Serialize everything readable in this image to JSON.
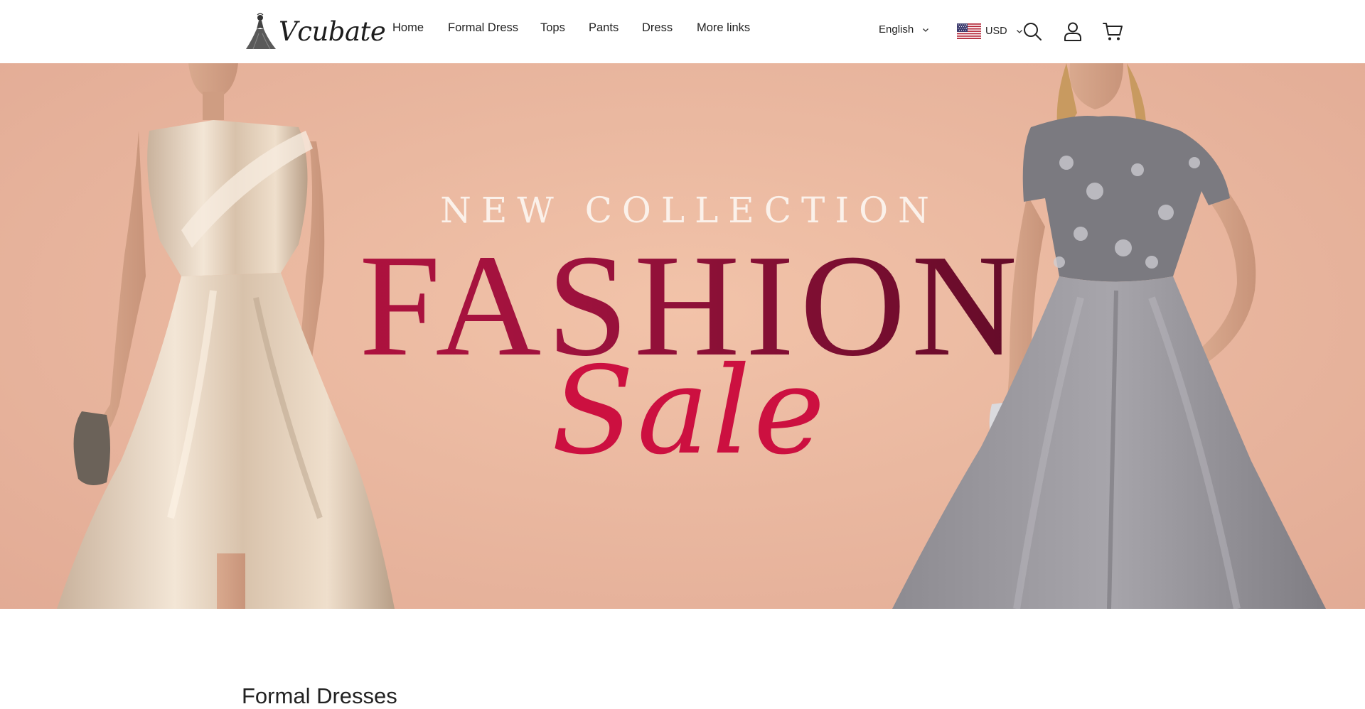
{
  "brand": {
    "name": "Vcubate"
  },
  "nav": {
    "items": [
      {
        "label": "Home"
      },
      {
        "label": "Formal Dress"
      },
      {
        "label": "Tops"
      },
      {
        "label": "Pants"
      },
      {
        "label": "Dress"
      },
      {
        "label": "More links"
      }
    ]
  },
  "language_selector": {
    "value": "English",
    "icon": "chevron-down-icon"
  },
  "currency_selector": {
    "value": "USD",
    "flag": "us-flag-icon",
    "icon": "chevron-down-icon"
  },
  "header_icons": {
    "search": "search-icon",
    "account": "user-icon",
    "cart": "cart-icon"
  },
  "hero": {
    "kicker": "NEW COLLECTION",
    "title": "FASHION",
    "script": "Sale",
    "colors": {
      "background": "#eab8a0",
      "title_start": "#c8103f",
      "title_end": "#4a0720",
      "script": "#cc1040",
      "kicker": "#fbf1ea"
    }
  },
  "section": {
    "title": "Formal Dresses"
  }
}
